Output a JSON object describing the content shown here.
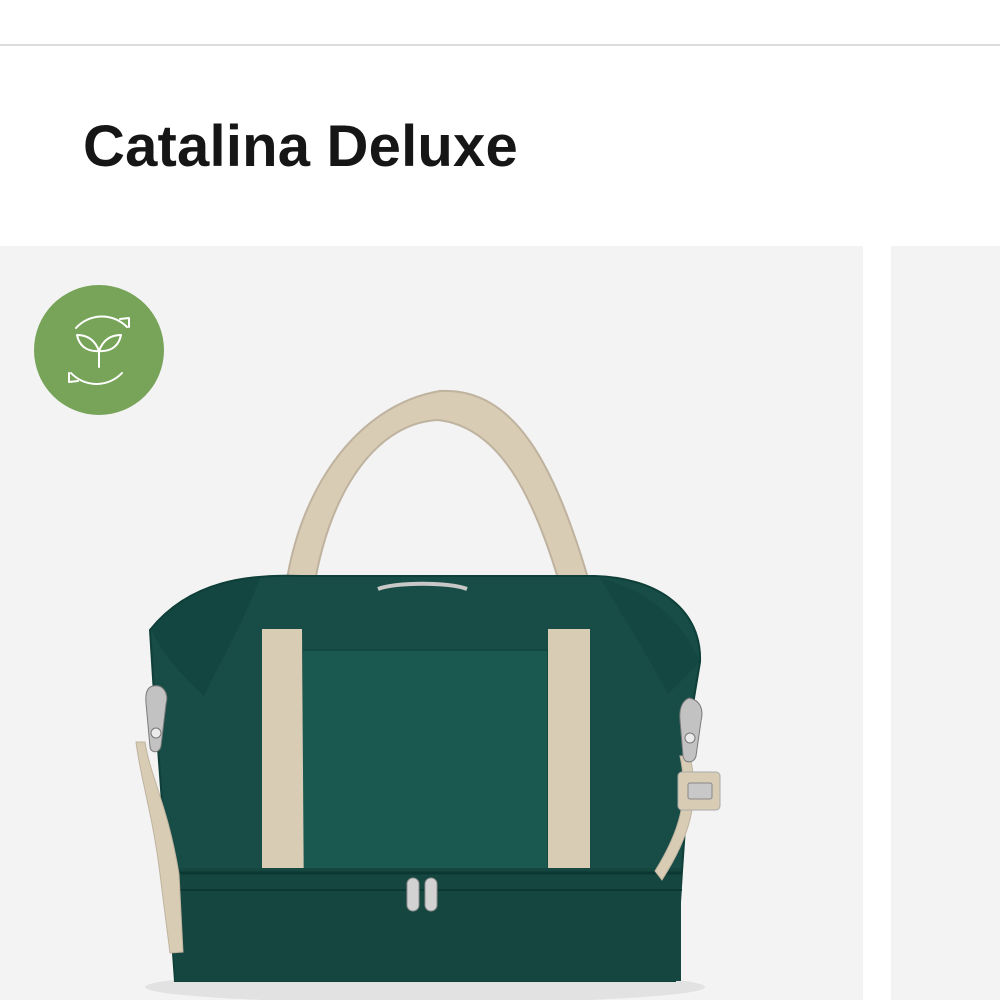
{
  "header": {
    "title": "Catalina Deluxe"
  },
  "product": {
    "image_subject": "bag",
    "badge_icon": "sustainable-leaf-icon",
    "colors": {
      "bag": "#174d46",
      "strap": "#d9ccb5",
      "badge": "#78a45a",
      "background": "#f3f3f3"
    }
  }
}
